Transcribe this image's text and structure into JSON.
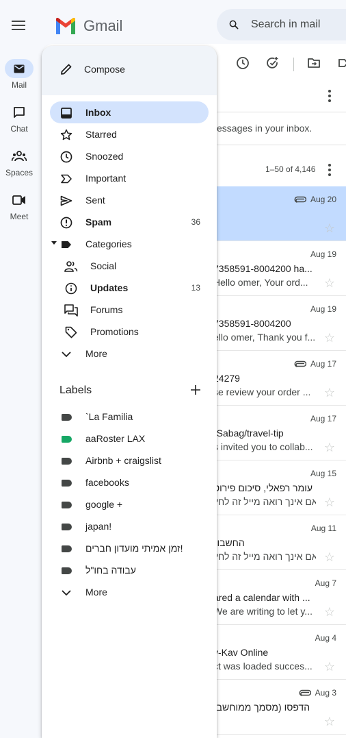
{
  "rail": {
    "items": [
      {
        "label": "Mail",
        "icon": "mail-icon",
        "active": true
      },
      {
        "label": "Chat",
        "icon": "chat-icon"
      },
      {
        "label": "Spaces",
        "icon": "spaces-icon"
      },
      {
        "label": "Meet",
        "icon": "meet-icon"
      }
    ]
  },
  "header": {
    "app_name": "Gmail",
    "search_placeholder": "Search in mail"
  },
  "drawer": {
    "compose_label": "Compose",
    "nav": [
      {
        "label": "Inbox",
        "icon": "inbox-icon",
        "active": true,
        "bold": true,
        "count": ""
      },
      {
        "label": "Starred",
        "icon": "star-icon",
        "count": ""
      },
      {
        "label": "Snoozed",
        "icon": "clock-icon",
        "count": ""
      },
      {
        "label": "Important",
        "icon": "important-icon",
        "count": ""
      },
      {
        "label": "Sent",
        "icon": "send-icon",
        "count": ""
      },
      {
        "label": "Spam",
        "icon": "spam-icon",
        "bold": true,
        "count": "36"
      },
      {
        "label": "Categories",
        "icon": "label-icon",
        "count": "",
        "expanded": true
      },
      {
        "label": "Social",
        "icon": "people-icon",
        "sub": true,
        "count": ""
      },
      {
        "label": "Updates",
        "icon": "info-icon",
        "sub": true,
        "bold": true,
        "count": "13"
      },
      {
        "label": "Forums",
        "icon": "forum-icon",
        "sub": true,
        "count": ""
      },
      {
        "label": "Promotions",
        "icon": "tag-icon",
        "sub": true,
        "count": ""
      },
      {
        "label": "More",
        "icon": "chevron-down-icon",
        "count": ""
      }
    ],
    "labels_heading": "Labels",
    "labels": [
      {
        "label": "`La Familia",
        "color": "#444746"
      },
      {
        "label": "aaRoster LAX",
        "color": "#16a765"
      },
      {
        "label": "Airbnb + craigslist",
        "color": "#444746"
      },
      {
        "label": "facebooks",
        "color": "#444746"
      },
      {
        "label": "google +",
        "color": "#444746"
      },
      {
        "label": "japan!",
        "color": "#444746"
      },
      {
        "label": "זמן אמיתי מועדון חברים!",
        "color": "#444746"
      },
      {
        "label": "עבודה בחו\"ל",
        "color": "#444746"
      }
    ],
    "labels_more": "More"
  },
  "main": {
    "banner_text": "essages in your inbox.",
    "pager_text": "1–50 of 4,146",
    "emails": [
      {
        "date": "Aug 20",
        "attach": true,
        "subject": "",
        "snippet": "",
        "selected": true
      },
      {
        "date": "Aug 19",
        "attach": false,
        "subject": "7358591-8004200 ha...",
        "snippet": "Hello omer, Your ord..."
      },
      {
        "date": "Aug 19",
        "attach": false,
        "subject": "7358591-8004200",
        "snippet": "ello omer, Thank you f..."
      },
      {
        "date": "Aug 17",
        "attach": true,
        "subject": "24279",
        "snippet": "se review your order ..."
      },
      {
        "date": "Aug 17",
        "attach": false,
        "subject": "rSabag/travel-tip",
        "snippet": "s invited you to collab..."
      },
      {
        "date": "Aug 15",
        "attach": false,
        "subject": "עומר רפאלי, סיכום פירוט",
        "snippet": "אם אינך רואה מייל זה לחץ"
      },
      {
        "date": "Aug 11",
        "attach": false,
        "subject": "החשבונ",
        "snippet": "אם אינך רואה מייל זה לחץ"
      },
      {
        "date": "Aug 7",
        "attach": false,
        "subject": "ared a calendar with ...",
        "snippet": "We are writing to let y..."
      },
      {
        "date": "Aug 4",
        "attach": false,
        "subject": "v-Kav Online",
        "snippet": "ct was loaded succes..."
      },
      {
        "date": "Aug 3",
        "attach": true,
        "subject": "(מסמך ממוחשב) הדפסו",
        "snippet": ""
      }
    ]
  },
  "colors": {
    "accent": "#d3e3fd",
    "selected_row": "#c2dbff",
    "gmail_red": "#ea4335",
    "gmail_blue": "#4285f4",
    "gmail_green": "#34a853",
    "gmail_yellow": "#fbbc04"
  }
}
